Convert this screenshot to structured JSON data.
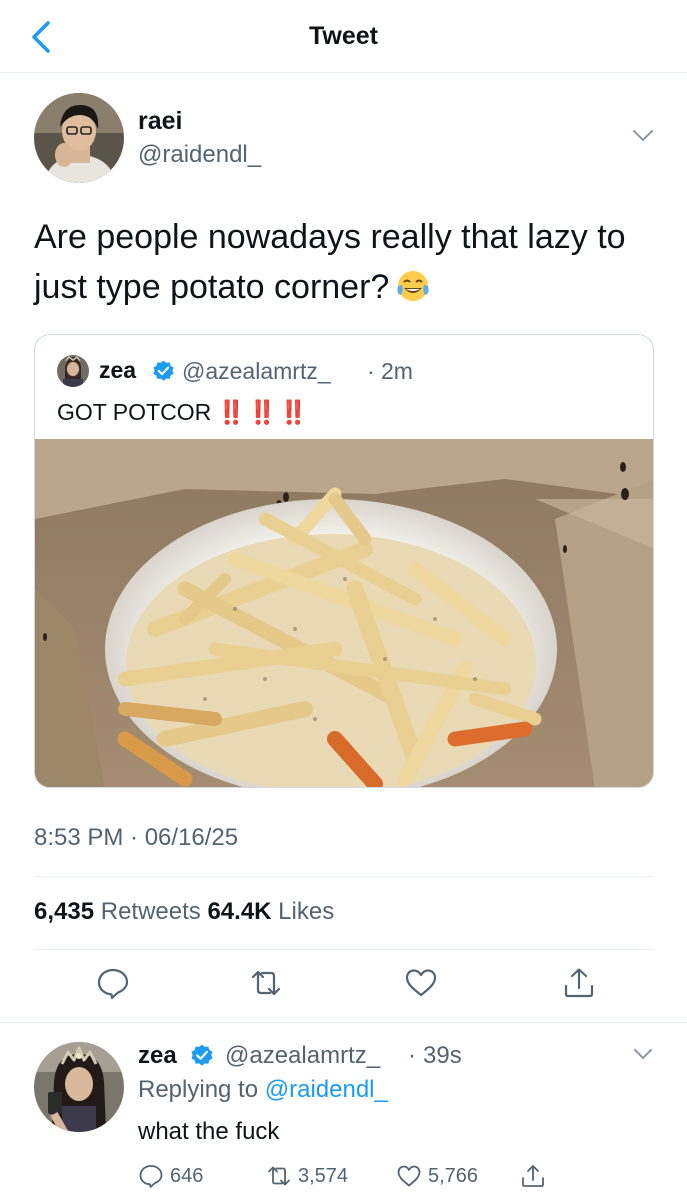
{
  "header": {
    "title": "Tweet",
    "back_icon": "chevron-left-icon",
    "accent": "#1d9bf0"
  },
  "tweet": {
    "author_name": "raei",
    "author_handle": "@raidendl_",
    "text": "Are people nowadays really that lazy to just type potato corner?",
    "emoji": "face-with-tears-of-joy",
    "timestamp": "8:53 PM · 06/16/25",
    "retweets": "6,435",
    "retweets_label": "Retweets",
    "likes": "64.4K",
    "likes_label": "Likes"
  },
  "quoted": {
    "author_name": "zea",
    "author_handle": "@azealamrtz_",
    "separator": "·",
    "time": "2m",
    "text": "GOT POTCOR",
    "exclamations": "‼️ ‼️ ‼️",
    "media": "bowl of seasoned french fries in a paper bag"
  },
  "actions": [
    "reply-icon",
    "retweet-icon",
    "like-icon",
    "share-icon"
  ],
  "reply": {
    "author_name": "zea",
    "author_handle": "@azealamrtz_",
    "separator": "·",
    "time": "39s",
    "replying_prefix": "Replying to",
    "replying_to": "@raidendl_",
    "text": "what the fuck",
    "reply_count": "646",
    "retweet_count": "3,574",
    "like_count": "5,766"
  }
}
